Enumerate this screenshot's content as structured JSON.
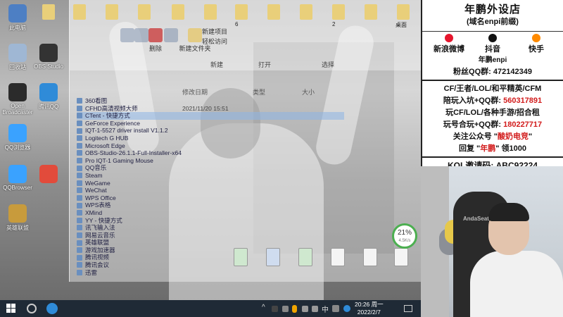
{
  "desktop": {
    "top_folders": [
      "",
      "",
      "",
      "",
      "",
      "",
      "",
      "",
      "",
      "",
      "",
      ""
    ],
    "top_labels": [
      "",
      "",
      "",
      "",
      "6",
      "",
      "2",
      "",
      "桌面"
    ],
    "icons": [
      {
        "label": "此电脑",
        "color": "#4d7fc4"
      },
      {
        "label": "回收站",
        "color": "#9fb7d4"
      },
      {
        "label": "OBS Studio",
        "color": "#333333"
      },
      {
        "label": "Open Broadcaster",
        "color": "#2b2b2b"
      },
      {
        "label": "腾讯QQ",
        "color": "#2f8bd8"
      },
      {
        "label": "QQ浏览器",
        "color": "#3aa2ff"
      },
      {
        "label": "QQBrowser",
        "color": "#3aa2ff"
      },
      {
        "label": "英雄联盟",
        "color": "#c89b3c"
      },
      {
        "label": "",
        "color": "#e24b3b"
      }
    ]
  },
  "explorer": {
    "ribbon_buttons": [
      {
        "label": "",
        "icon": "copy-icon"
      },
      {
        "label": "",
        "icon": "paste-icon"
      },
      {
        "label": "删除",
        "icon": "delete-icon"
      },
      {
        "label": "",
        "icon": "rename-icon"
      },
      {
        "label": "新建文件夹",
        "icon": "new-folder-icon"
      }
    ],
    "ribbon_groups": [
      "",
      "新建",
      "打开",
      "选择"
    ],
    "menu": [
      "新建项目",
      "轻松访问"
    ],
    "columns": [
      "",
      "修改日期",
      "类型",
      "大小"
    ],
    "files": [
      {
        "name": "360看图",
        "date": "",
        "selected": false
      },
      {
        "name": "CFHD高清视频大师",
        "date": "2021/11/20 15:51",
        "selected": false
      },
      {
        "name": "CTent - 快捷方式",
        "date": "",
        "selected": true
      },
      {
        "name": "GeForce Experience",
        "date": "",
        "selected": false
      },
      {
        "name": "IQT-1-5527 driver install V1.1.2",
        "date": "",
        "selected": false
      },
      {
        "name": "Logitech G HUB",
        "date": "",
        "selected": false
      },
      {
        "name": "Microsoft Edge",
        "date": "",
        "selected": false
      },
      {
        "name": "OBS-Studio-26.1.1-Full-Installer-x64",
        "date": "",
        "selected": false
      },
      {
        "name": "Pro IQT-1 Gaming Mouse",
        "date": "",
        "selected": false
      },
      {
        "name": "QQ音乐",
        "date": "",
        "selected": false
      },
      {
        "name": "Steam",
        "date": "",
        "selected": false
      },
      {
        "name": "WeGame",
        "date": "",
        "selected": false
      },
      {
        "name": "WeChat",
        "date": "",
        "selected": false
      },
      {
        "name": "WPS Office",
        "date": "",
        "selected": false
      },
      {
        "name": "WPS表格",
        "date": "",
        "selected": false
      },
      {
        "name": "XMind",
        "date": "",
        "selected": false
      },
      {
        "name": "YY - 快捷方式",
        "date": "",
        "selected": false
      },
      {
        "name": "讯飞输入法",
        "date": "",
        "selected": false
      },
      {
        "name": "网易云音乐",
        "date": "",
        "selected": false
      },
      {
        "name": "英雄联盟",
        "date": "",
        "selected": false
      },
      {
        "name": "游戏加速器",
        "date": "",
        "selected": false
      },
      {
        "name": "腾讯视频",
        "date": "",
        "selected": false
      },
      {
        "name": "腾讯会议",
        "date": "",
        "selected": false
      },
      {
        "name": "迅雷",
        "date": "",
        "selected": false
      }
    ],
    "bottom_files": [
      {
        "label": "",
        "style": "green"
      },
      {
        "label": "",
        "style": "blue"
      },
      {
        "label": "",
        "style": "green"
      },
      {
        "label": "",
        "style": ""
      },
      {
        "label": "",
        "style": ""
      },
      {
        "label": "",
        "style": ""
      }
    ]
  },
  "gauge": {
    "value": "21%",
    "sub": "4.5K/s"
  },
  "taskbar": {
    "clock_time": "20:26 周一",
    "clock_date": "2022/2/7",
    "tray_text": "中"
  },
  "promo": {
    "title": "年鹏外设店",
    "subtitle": "(域名enpi前缀)",
    "social": [
      {
        "label": "新浪微博",
        "icon": "weibo-icon",
        "color": "#e6162d"
      },
      {
        "label": "抖音",
        "icon": "douyin-icon",
        "color": "#111111"
      },
      {
        "label": "快手",
        "icon": "kuaishou-icon",
        "color": "#ff8a00"
      }
    ],
    "handle": "年鹏enpi",
    "qq_group": "粉丝QQ群: 472142349",
    "line1_text": "CF/王者/LOL/和平精英/CFM",
    "line2_prefix": "陪玩入坑+QQ群: ",
    "line2_number": "560317891",
    "line3_text": "玩CF/LOL/各种手游/招合租",
    "line4_prefix": "玩号合玩+QQ群: ",
    "line4_number": "180227717",
    "line5_prefix": "关注公众号 \"",
    "line5_highlight": "酸奶电竞",
    "line5_suffix": "\"",
    "line6_prefix": "回复 \"",
    "line6_highlight": "年鹏",
    "line6_suffix": "\" 领1000",
    "kol": "KOL邀请码: ABC92224"
  },
  "webcam": {
    "chair_brand": "AndaSeat"
  }
}
